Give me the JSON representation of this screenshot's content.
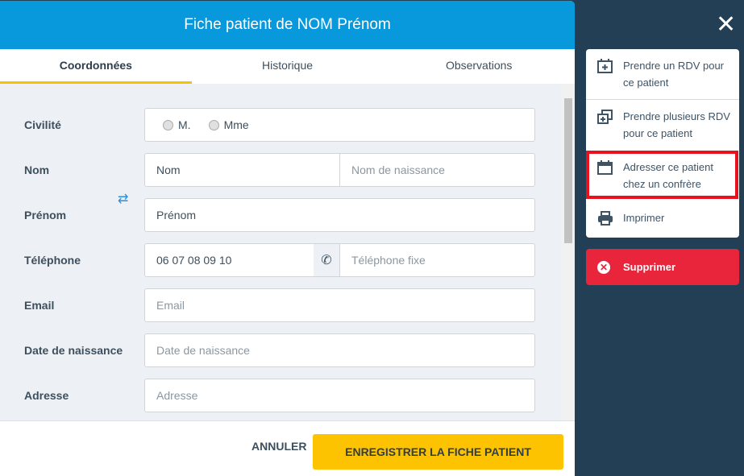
{
  "header": {
    "title": "Fiche patient de NOM Prénom"
  },
  "tabs": [
    {
      "label": "Coordonnées"
    },
    {
      "label": "Historique"
    },
    {
      "label": "Observations"
    }
  ],
  "form": {
    "civilite": {
      "label": "Civilité",
      "options": [
        "M.",
        "Mme"
      ]
    },
    "nom": {
      "label": "Nom",
      "value": "Nom",
      "birth_placeholder": "Nom de naissance"
    },
    "prenom": {
      "label": "Prénom",
      "value": "Prénom"
    },
    "telephone": {
      "label": "Téléphone",
      "value": "06 07 08 09 10",
      "fixe_placeholder": "Téléphone fixe"
    },
    "email": {
      "label": "Email",
      "placeholder": "Email"
    },
    "naissance": {
      "label": "Date de naissance",
      "placeholder": "Date de naissance"
    },
    "adresse": {
      "label": "Adresse",
      "placeholder": "Adresse"
    }
  },
  "footer": {
    "cancel": "ANNULER",
    "save": "ENREGISTRER LA FICHE PATIENT"
  },
  "side_menu": {
    "items": [
      {
        "label1": "Prendre un RDV pour",
        "label2": "ce patient",
        "icon": "calendar-plus-icon"
      },
      {
        "label1": "Prendre plusieurs RDV",
        "label2": "pour ce patient",
        "icon": "calendar-multiple-icon"
      },
      {
        "label1": "Adresser ce patient",
        "label2": "chez un confrère",
        "icon": "calendar-icon"
      },
      {
        "label1": "Imprimer",
        "icon": "printer-icon"
      }
    ],
    "delete": "Supprimer"
  },
  "colors": {
    "header": "#0899dc",
    "accent": "#fdc300",
    "danger": "#e8253a",
    "sidebar": "#233f55",
    "highlight": "#e8121e"
  }
}
